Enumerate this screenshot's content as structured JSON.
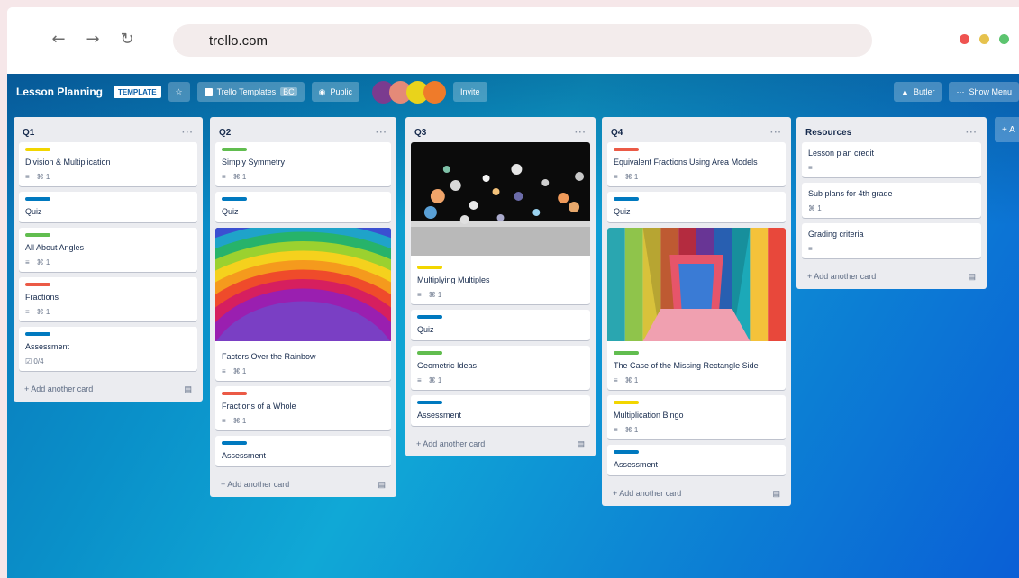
{
  "browser": {
    "url": "trello.com",
    "back_icon": "←",
    "forward_icon": "→",
    "reload_icon": "↻",
    "window_dots": [
      "#ef5350",
      "#e6c24d",
      "#5cc46f"
    ]
  },
  "header": {
    "board_title": "Lesson Planning",
    "template_badge": "TEMPLATE",
    "star_icon": "☆",
    "workspace_button": "Trello Templates",
    "workspace_badge": "BC",
    "visibility_button": "Public",
    "avatar_colors": [
      "#7b3b8f",
      "#e48a78",
      "#e9d31b",
      "#ef7b2a"
    ],
    "invite_button": "Invite",
    "butler_button": "Butler",
    "menu_button": "Show Menu"
  },
  "lists": [
    {
      "title": "Q1",
      "cards": [
        {
          "label": "#f2d600",
          "title": "Division & Multiplication",
          "meta": [
            "≡",
            "⌘ 1"
          ]
        },
        {
          "label": "#0079bf",
          "title": "Quiz",
          "meta": []
        },
        {
          "label": "#61bd4f",
          "title": "All About Angles",
          "meta": [
            "≡",
            "⌘ 1"
          ]
        },
        {
          "label": "#eb5a46",
          "title": "Fractions",
          "meta": [
            "≡",
            "⌘ 1"
          ]
        },
        {
          "label": "#0079bf",
          "title": "Assessment",
          "meta": [
            "☑ 0/4"
          ]
        }
      ],
      "add": "+ Add another card"
    },
    {
      "title": "Q2",
      "cards": [
        {
          "label": "#61bd4f",
          "title": "Simply Symmetry",
          "meta": [
            "≡",
            "⌘ 1"
          ]
        },
        {
          "label": "#0079bf",
          "title": "Quiz",
          "meta": []
        },
        {
          "cover": "rainbow",
          "title": "Factors Over the Rainbow",
          "meta": [
            "≡",
            "⌘ 1"
          ]
        },
        {
          "label": "#eb5a46",
          "title": "Fractions of a Whole",
          "meta": [
            "≡",
            "⌘ 1"
          ]
        },
        {
          "label": "#0079bf",
          "title": "Assessment",
          "meta": []
        }
      ],
      "add": "+ Add another card"
    },
    {
      "title": "Q3",
      "cards": [
        {
          "cover": "spheres",
          "label": "#f2d600",
          "title": "Multiplying Multiples",
          "meta": [
            "≡",
            "⌘ 1"
          ]
        },
        {
          "label": "#0079bf",
          "title": "Quiz",
          "meta": []
        },
        {
          "label": "#61bd4f",
          "title": "Geometric Ideas",
          "meta": [
            "≡",
            "⌘ 1"
          ]
        },
        {
          "label": "#0079bf",
          "title": "Assessment",
          "meta": []
        }
      ],
      "add": "+ Add another card"
    },
    {
      "title": "Q4",
      "cards": [
        {
          "label": "#eb5a46",
          "title": "Equivalent Fractions Using Area Models",
          "meta": [
            "≡",
            "⌘ 1"
          ]
        },
        {
          "label": "#0079bf",
          "title": "Quiz",
          "meta": []
        },
        {
          "cover": "corridor",
          "label": "#61bd4f",
          "title": "The Case of the Missing Rectangle Side",
          "meta": [
            "≡",
            "⌘ 1"
          ]
        },
        {
          "label": "#f2d600",
          "title": "Multiplication Bingo",
          "meta": [
            "≡",
            "⌘ 1"
          ]
        },
        {
          "label": "#0079bf",
          "title": "Assessment",
          "meta": []
        }
      ],
      "add": "+ Add another card"
    },
    {
      "title": "Resources",
      "cards": [
        {
          "title": "Lesson plan credit",
          "meta": [
            "≡"
          ]
        },
        {
          "title": "Sub plans for 4th grade",
          "meta": [
            "⌘ 1"
          ]
        },
        {
          "title": "Grading criteria",
          "meta": [
            "≡"
          ]
        }
      ],
      "add": "+ Add another card"
    }
  ],
  "add_list": "+ A"
}
